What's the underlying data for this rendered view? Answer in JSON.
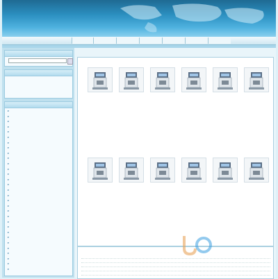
{
  "header": {
    "logo_text": "",
    "code": ""
  },
  "nav": {
    "items": [
      "",
      "",
      "",
      "",
      "",
      "",
      ""
    ]
  },
  "sidebar": {
    "search": {
      "title": "",
      "button_label": ""
    },
    "links": {
      "title": "",
      "items": [
        "",
        ""
      ]
    },
    "categories": {
      "title": "",
      "items": [
        "",
        "",
        "",
        "",
        "",
        "",
        "",
        "",
        "",
        "",
        "",
        "",
        "",
        "",
        "",
        "",
        "",
        "",
        "",
        "",
        "",
        "",
        "",
        "",
        "",
        "",
        "",
        "",
        "",
        "",
        ""
      ]
    }
  },
  "products": {
    "title": "",
    "items": [
      {
        "caption": ""
      },
      {
        "caption": ""
      },
      {
        "caption": ""
      },
      {
        "caption": ""
      },
      {
        "caption": ""
      },
      {
        "caption": ""
      },
      {
        "caption": ""
      },
      {
        "caption": ""
      },
      {
        "caption": ""
      },
      {
        "caption": ""
      },
      {
        "caption": ""
      },
      {
        "caption": ""
      }
    ]
  },
  "news": {
    "title": "",
    "rows": [
      {
        "title": "",
        "date": ""
      },
      {
        "title": "",
        "date": ""
      },
      {
        "title": "",
        "date": ""
      },
      {
        "title": "",
        "date": ""
      },
      {
        "title": "",
        "date": ""
      },
      {
        "title": "",
        "date": ""
      }
    ]
  },
  "watermark": {
    "subtitle": ""
  }
}
